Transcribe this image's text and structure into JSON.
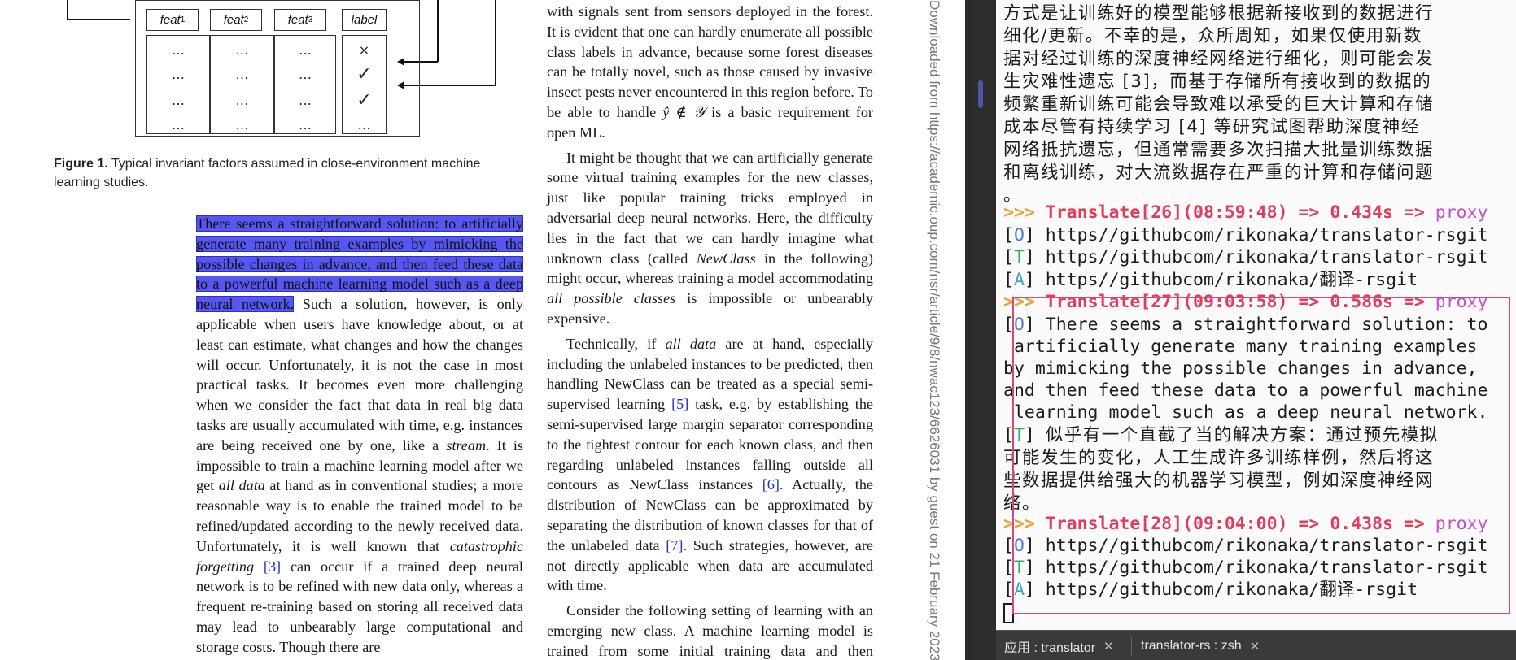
{
  "figure": {
    "headers": [
      {
        "base": "feat",
        "sub": "1"
      },
      {
        "base": "feat",
        "sub": "2"
      },
      {
        "base": "feat",
        "sub": "3"
      },
      {
        "base": "label",
        "sub": ""
      }
    ],
    "rows": [
      [
        "…",
        "…",
        "…",
        "×"
      ],
      [
        "…",
        "…",
        "…",
        "✓"
      ],
      [
        "…",
        "…",
        "…",
        "✓"
      ],
      [
        "…",
        "…",
        "…",
        "…"
      ]
    ],
    "caption_label": "Figure 1.",
    "caption_text": " Typical invariant factors assumed in close-environment machine learning studies."
  },
  "left_column": {
    "highlighted": "There seems a straightforward solution: to artificially generate many training examples by mimicking the possible changes in advance, and then feed these data to a powerful machine learning model such as a deep neural network.",
    "t1": " Such a solution, however, is only applicable when users have knowledge about, or at least can estimate, what changes and how the changes will occur. Unfortunately, it is not the case in most practical tasks. It becomes even more challenging when we consider the fact that data in real big data tasks are usually accumulated with time, e.g. instances are being received one by one, like a ",
    "i1": "stream",
    "t2": ". It is impossible to train a machine learning model after we get ",
    "i2": "all data",
    "t3": " at hand as in conventional studies; a more reasonable way is to enable the trained model to be refined/updated according to the newly received data. Unfortunately, it is well known that ",
    "i3": "catastrophic forgetting",
    "c1": "[3]",
    "t4": " can occur if a trained deep neural network is to be refined with new data only, whereas a frequent re-training based on storing all received data may lead to unbearably large computational and storage costs. Though there are"
  },
  "right_column": {
    "p1a": "with signals sent from sensors deployed in the forest. It is evident that one can hardly enumerate all possible class labels in advance, because some forest diseases can be totally novel, such as those caused by invasive insect pests never encountered in this region before. To be able to handle ",
    "p1m": "ŷ ∉ 𝒴",
    "p1b": " is a basic requirement for open ML.",
    "p2a": "It might be thought that we can artificially generate some virtual training examples for the new classes, just like popular training tricks employed in adversarial deep neural networks. Here, the difficulty lies in the fact that we can hardly imagine what unknown class (called ",
    "p2i": "NewClass",
    "p2b": " in the following) might occur, whereas training a model accommodating ",
    "p2i2": "all possible classes",
    "p2c": " is impossible or unbearably expensive.",
    "p3a": "Technically, if ",
    "p3i": "all data",
    "p3b": " are at hand, especially including the unlabeled instances to be predicted, then handling NewClass can be treated as a special semi-supervised learning ",
    "p3c1": "[5]",
    "p3c": " task, e.g. by establishing the semi-supervised large margin separator corresponding to the tightest contour for each known class, and then regarding unlabeled instances falling outside all contours as NewClass instances ",
    "p3c2": "[6]",
    "p3d": ". Actually, the distribution of NewClass can be approximated by separating the distribution of known classes for that of the unlabeled data ",
    "p3c3": "[7]",
    "p3e": ". Such strategies, however, are not directly applicable when data are accumulated with time.",
    "p4": "Consider the following setting of learning with an emerging new class. A machine learning model is trained from some initial training data and then deployed to handle unseen instances being received"
  },
  "watermark": "Downloaded from https://academic.oup.com/nsr/article/9/8/nwac123/6626031 by guest on 21 February 2023",
  "terminal": {
    "zh_prev": [
      "方式是让训练好的模型能够根据新接收到的数据进行",
      "细化/更新。不幸的是，众所周知，如果仅使用新数",
      "据对经过训练的深度神经网络进行细化，则可能会发",
      "生灾难性遗忘 [3]，而基于存储所有接收到的数据的",
      "频繁重新训练可能会导致难以承受的巨大计算和存储",
      "成本尽管有持续学习 [4] 等研究试图帮助深度神经",
      "网络抵抗遗忘，但通常需要多次扫描大批量训练数据",
      "和离线训练，对大流数据存在严重的计算和存储问题",
      "。"
    ],
    "prompt": ">>>",
    "arrow": "=>",
    "proxy": "proxy",
    "tag_O": "O",
    "tag_T": "T",
    "tag_A": "A",
    "block26": {
      "head": "Translate[26](08:59:48)",
      "time": "0.434s",
      "O": "https//githubcom/rikonaka/translator-rsgit",
      "T": "https//githubcom/rikonaka/translator-rsgit",
      "A": "https//githubcom/rikonaka/翻译-rsgit"
    },
    "block27": {
      "head": "Translate[27](09:03:58)",
      "time": "0.586s",
      "O": [
        "There seems a straightforward solution: to",
        " artificially generate many training examples",
        "by mimicking the possible changes in advance,",
        "and then feed these data to a powerful machine",
        " learning model such as a deep neural network."
      ],
      "T": [
        "似乎有一个直截了当的解决方案：通过预先模拟",
        "可能发生的变化，人工生成许多训练样例，然后将这",
        "些数据提供给强大的机器学习模型，例如深度神经网",
        "络。"
      ]
    },
    "block28": {
      "head": "Translate[28](09:04:00)",
      "time": "0.438s",
      "O": "https//githubcom/rikonaka/translator-rsgit",
      "T": "https//githubcom/rikonaka/translator-rsgit",
      "A": "https//githubcom/rikonaka/翻译-rsgit"
    },
    "tabs": [
      {
        "label": "应用 : translator"
      },
      {
        "label": "translator-rs : zsh"
      }
    ]
  }
}
